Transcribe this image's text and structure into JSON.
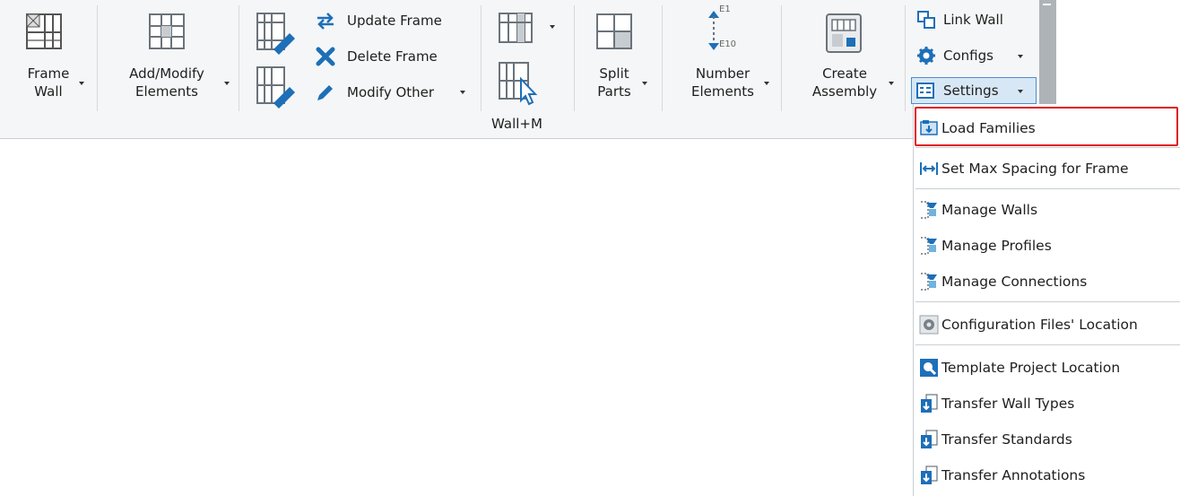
{
  "ribbon": {
    "frame_wall": {
      "line1": "Frame",
      "line2": "Wall"
    },
    "add_modify": {
      "line1": "Add/Modify",
      "line2": "Elements"
    },
    "update_frame": "Update Frame",
    "delete_frame": "Delete Frame",
    "modify_other": "Modify Other",
    "split_parts": {
      "line1": "Split",
      "line2": "Parts"
    },
    "number_elements": {
      "line1": "Number",
      "line2": "Elements",
      "icon_top": "E1",
      "icon_bottom": "E10"
    },
    "create_assembly": {
      "line1": "Create",
      "line2": "Assembly"
    },
    "link_wall": "Link Wall",
    "configs": "Configs",
    "settings": "Settings",
    "panel_title": "Wall+M"
  },
  "menu": {
    "items": [
      {
        "label": "Load Families",
        "icon": "load-families-icon",
        "highlighted": true
      },
      {
        "label": "Set Max Spacing for Frame",
        "icon": "spacing-arrows-icon"
      },
      {
        "label": "Manage Walls",
        "icon": "manage-icon"
      },
      {
        "label": "Manage Profiles",
        "icon": "manage-icon"
      },
      {
        "label": "Manage Connections",
        "icon": "manage-icon"
      },
      {
        "label": "Configuration Files' Location",
        "icon": "config-gear-icon"
      },
      {
        "label": "Template Project Location",
        "icon": "template-search-icon"
      },
      {
        "label": "Transfer Wall Types",
        "icon": "transfer-icon"
      },
      {
        "label": "Transfer Standards",
        "icon": "transfer-icon"
      },
      {
        "label": "Transfer Annotations",
        "icon": "transfer-icon"
      }
    ]
  },
  "colors": {
    "ribbon_bg": "#f5f6f7",
    "highlight_border": "#e0191f",
    "settings_active_bg": "#d7e7f5",
    "settings_active_border": "#4c8ccf",
    "icon_blue": "#1d6fb8",
    "icon_gray": "#7a8087"
  }
}
